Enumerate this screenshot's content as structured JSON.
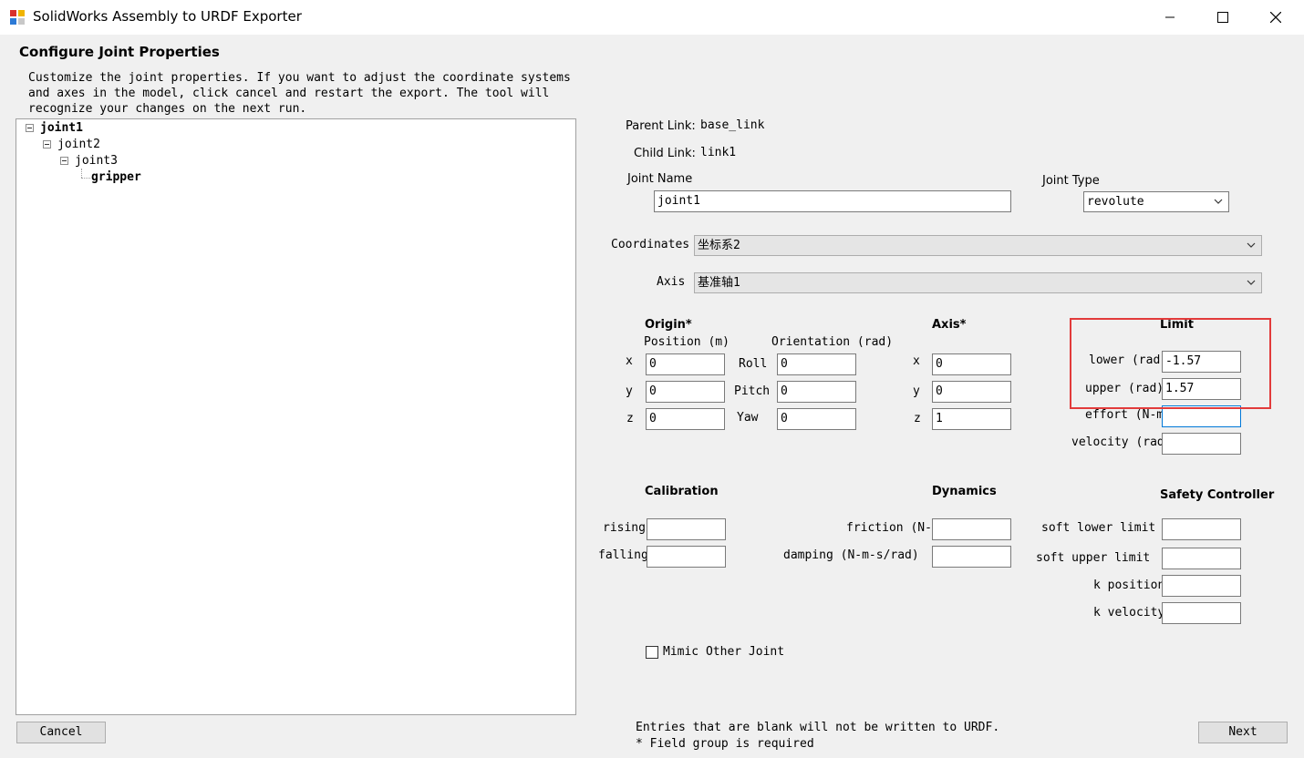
{
  "window": {
    "title": "SolidWorks Assembly to URDF Exporter",
    "controls": {
      "minimize": "minimize",
      "maximize": "maximize",
      "close": "close"
    }
  },
  "page": {
    "heading": "Configure Joint Properties",
    "description": "Customize the joint properties. If you want to adjust the coordinate systems\nand axes in the model, click cancel and restart the export. The tool will\nrecognize your changes on the next run."
  },
  "tree": {
    "nodes": [
      {
        "label": "joint1",
        "bold": true,
        "expanded": true
      },
      {
        "label": "joint2",
        "bold": false,
        "expanded": true
      },
      {
        "label": "joint3",
        "bold": false,
        "expanded": true
      },
      {
        "label": "gripper",
        "bold": true
      }
    ]
  },
  "links": {
    "parent_label": "Parent Link:",
    "parent_value": "base_link",
    "child_label": "Child Link:",
    "child_value": "link1"
  },
  "joint": {
    "name_label": "Joint Name",
    "name_value": "joint1",
    "type_label": "Joint Type",
    "type_value": "revolute"
  },
  "coordinates": {
    "label": "Coordinates",
    "value": "坐标系2"
  },
  "axis_select": {
    "label": "Axis",
    "value": "基准轴1"
  },
  "origin": {
    "title": "Origin*",
    "position_label": "Position (m)",
    "orientation_label": "Orientation (rad)",
    "x_label": "x",
    "y_label": "y",
    "z_label": "z",
    "roll_label": "Roll",
    "pitch_label": "Pitch",
    "yaw_label": "Yaw",
    "x": "0",
    "y": "0",
    "z": "0",
    "roll": "0",
    "pitch": "0",
    "yaw": "0"
  },
  "axis": {
    "title": "Axis*",
    "x_label": "x",
    "y_label": "y",
    "z_label": "z",
    "x": "0",
    "y": "0",
    "z": "1"
  },
  "limit": {
    "title": "Limit",
    "lower_label": "lower (rad",
    "lower": "-1.57",
    "upper_label": "upper (rad)",
    "upper": "1.57",
    "effort_label": "effort (N-m",
    "effort": "",
    "velocity_label": "velocity (rad",
    "velocity": ""
  },
  "calibration": {
    "title": "Calibration",
    "rising_label": "rising",
    "rising": "",
    "falling_label": "falling",
    "falling": ""
  },
  "dynamics": {
    "title": "Dynamics",
    "friction_label": "friction (N-",
    "friction": "",
    "damping_label": "damping (N-m-s/rad)",
    "damping": ""
  },
  "safety": {
    "title": "Safety Controller",
    "soft_lower_label": "soft lower limit",
    "soft_lower": "",
    "soft_upper_label": "soft upper limit",
    "soft_upper": "",
    "k_position_label": "k position",
    "k_position": "",
    "k_velocity_label": "k velocity",
    "k_velocity": ""
  },
  "mimic": {
    "label": "Mimic Other Joint",
    "checked": false
  },
  "footer": {
    "note1": "Entries that are blank will not be written to URDF.",
    "note2": "* Field group is required",
    "cancel": "Cancel",
    "next": "Next"
  },
  "colors": {
    "highlight": "#e23b3b",
    "focus_border": "#0078d7",
    "window_bg": "#f0f0f0"
  }
}
